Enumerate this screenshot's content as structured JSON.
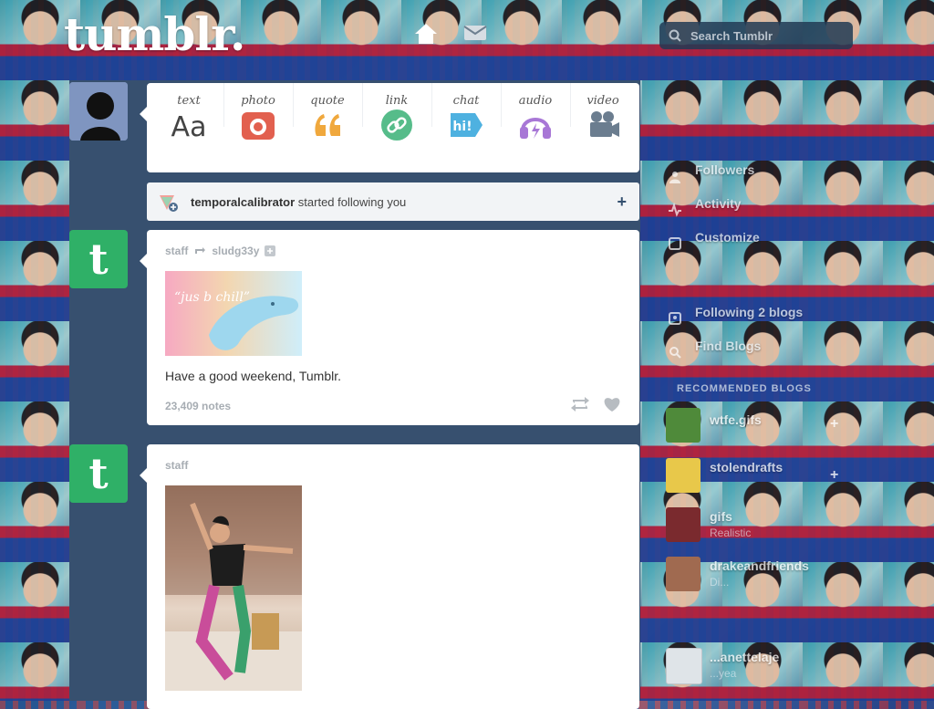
{
  "header": {
    "logo": "tumblr.",
    "search_placeholder": "Search Tumblr"
  },
  "post_types": [
    {
      "label": "text",
      "icon": "text-aa-icon",
      "color": "#444444"
    },
    {
      "label": "photo",
      "icon": "camera-icon",
      "color": "#e2604f"
    },
    {
      "label": "quote",
      "icon": "quote-marks-icon",
      "color": "#f0a83d"
    },
    {
      "label": "link",
      "icon": "chain-link-icon",
      "color": "#56bc8a"
    },
    {
      "label": "chat",
      "icon": "chat-bubble-icon",
      "color": "#4eb1e0"
    },
    {
      "label": "audio",
      "icon": "headphones-icon",
      "color": "#a877d6"
    },
    {
      "label": "video",
      "icon": "video-camera-icon",
      "color": "#6b7d8f"
    }
  ],
  "notification": {
    "user": "temporalcalibrator",
    "text": "started following you"
  },
  "posts": [
    {
      "author": "staff",
      "reblogged_from": "sludg33y",
      "image_text": "“jus b chill”",
      "caption": "Have a good weekend, Tumblr.",
      "notes": "23,409 notes"
    },
    {
      "author": "staff"
    }
  ],
  "sidebar": {
    "items": [
      {
        "label": "Followers",
        "icon": "followers-icon"
      },
      {
        "label": "Activity",
        "icon": "activity-icon"
      },
      {
        "label": "Customize",
        "icon": "customize-icon"
      },
      {
        "label": "Following 2 blogs",
        "icon": "following-icon"
      },
      {
        "label": "Find Blogs",
        "icon": "find-blogs-icon"
      }
    ],
    "recommended_label": "RECOMMENDED BLOGS",
    "recommended": [
      {
        "name": "wtfe.gifs",
        "sub": ""
      },
      {
        "name": "stolendrafts",
        "sub": ""
      },
      {
        "name": "gifs",
        "sub": "Realistic"
      },
      {
        "name": "drakeandfriends",
        "sub": "Di..."
      },
      {
        "name": "...anettelaje",
        "sub": "...yea"
      }
    ]
  }
}
